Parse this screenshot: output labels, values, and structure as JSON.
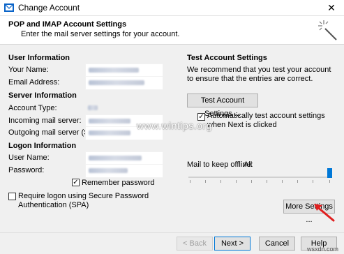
{
  "window": {
    "title": "Change Account"
  },
  "header": {
    "title": "POP and IMAP Account Settings",
    "subtitle": "Enter the mail server settings for your account."
  },
  "user_info": {
    "heading": "User Information",
    "your_name_label": "Your Name:",
    "email_label": "Email Address:"
  },
  "server_info": {
    "heading": "Server Information",
    "account_type_label": "Account Type:",
    "incoming_label": "Incoming mail server:",
    "outgoing_label": "Outgoing mail server (SMTP):"
  },
  "logon_info": {
    "heading": "Logon Information",
    "user_name_label": "User Name:",
    "password_label": "Password:",
    "remember_password_label": "Remember password",
    "remember_password_checked": true,
    "spa_label": "Require logon using Secure Password Authentication (SPA)",
    "spa_checked": false
  },
  "test": {
    "heading": "Test Account Settings",
    "description": "We recommend that you test your account to ensure that the entries are correct.",
    "button_label": "Test Account Settings ...",
    "auto_test_label": "Automatically test account settings when Next is clicked",
    "auto_test_checked": true
  },
  "offline": {
    "label": "Mail to keep offline:",
    "value": "All",
    "slider_level": 1.0
  },
  "more_settings_label": "More Settings ...",
  "footer": {
    "back_label": "< Back",
    "next_label": "Next >",
    "cancel_label": "Cancel",
    "help_label": "Help"
  },
  "watermark": "www.wintips.org",
  "site_mark": "wsxdn.com",
  "colors": {
    "accent": "#0078d7",
    "arrow": "#e02020"
  }
}
